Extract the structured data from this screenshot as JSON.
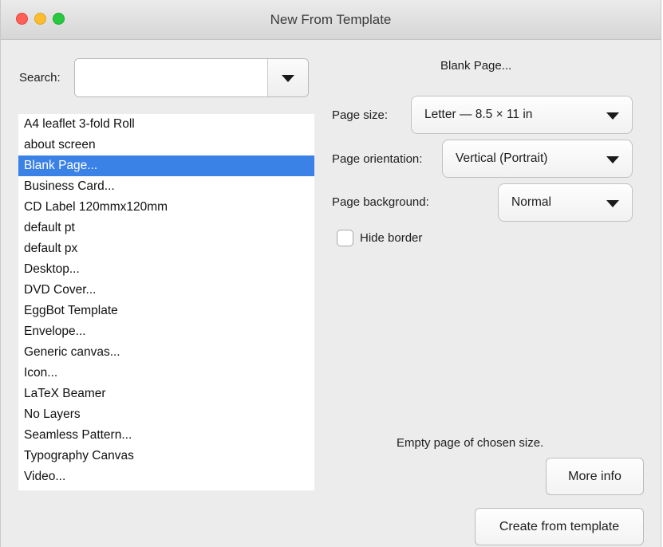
{
  "window": {
    "title": "New From Template"
  },
  "search": {
    "label": "Search:",
    "value": "",
    "placeholder": ""
  },
  "templates": [
    "A4 leaflet 3-fold Roll",
    "about screen",
    "Blank Page...",
    "Business Card...",
    "CD Label 120mmx120mm",
    "default pt",
    "default px",
    "Desktop...",
    "DVD Cover...",
    "EggBot Template",
    "Envelope...",
    "Generic canvas...",
    "Icon...",
    "LaTeX Beamer",
    "No Layers",
    "Seamless Pattern...",
    "Typography Canvas",
    "Video..."
  ],
  "selected_template": "Blank Page...",
  "detail": {
    "heading": "Blank Page...",
    "page_size_label": "Page size:",
    "page_size_value": "Letter — 8.5 × 11 in",
    "orientation_label": "Page orientation:",
    "orientation_value": "Vertical (Portrait)",
    "background_label": "Page background:",
    "background_value": "Normal",
    "hide_border_label": "Hide border",
    "hide_border_checked": false,
    "description": "Empty page of chosen size.",
    "more_info_label": "More info",
    "create_label": "Create from template"
  },
  "colors": {
    "selection": "#3b82e6",
    "close": "#fe5f57",
    "minimize": "#febc2e",
    "maximize": "#28c840"
  }
}
